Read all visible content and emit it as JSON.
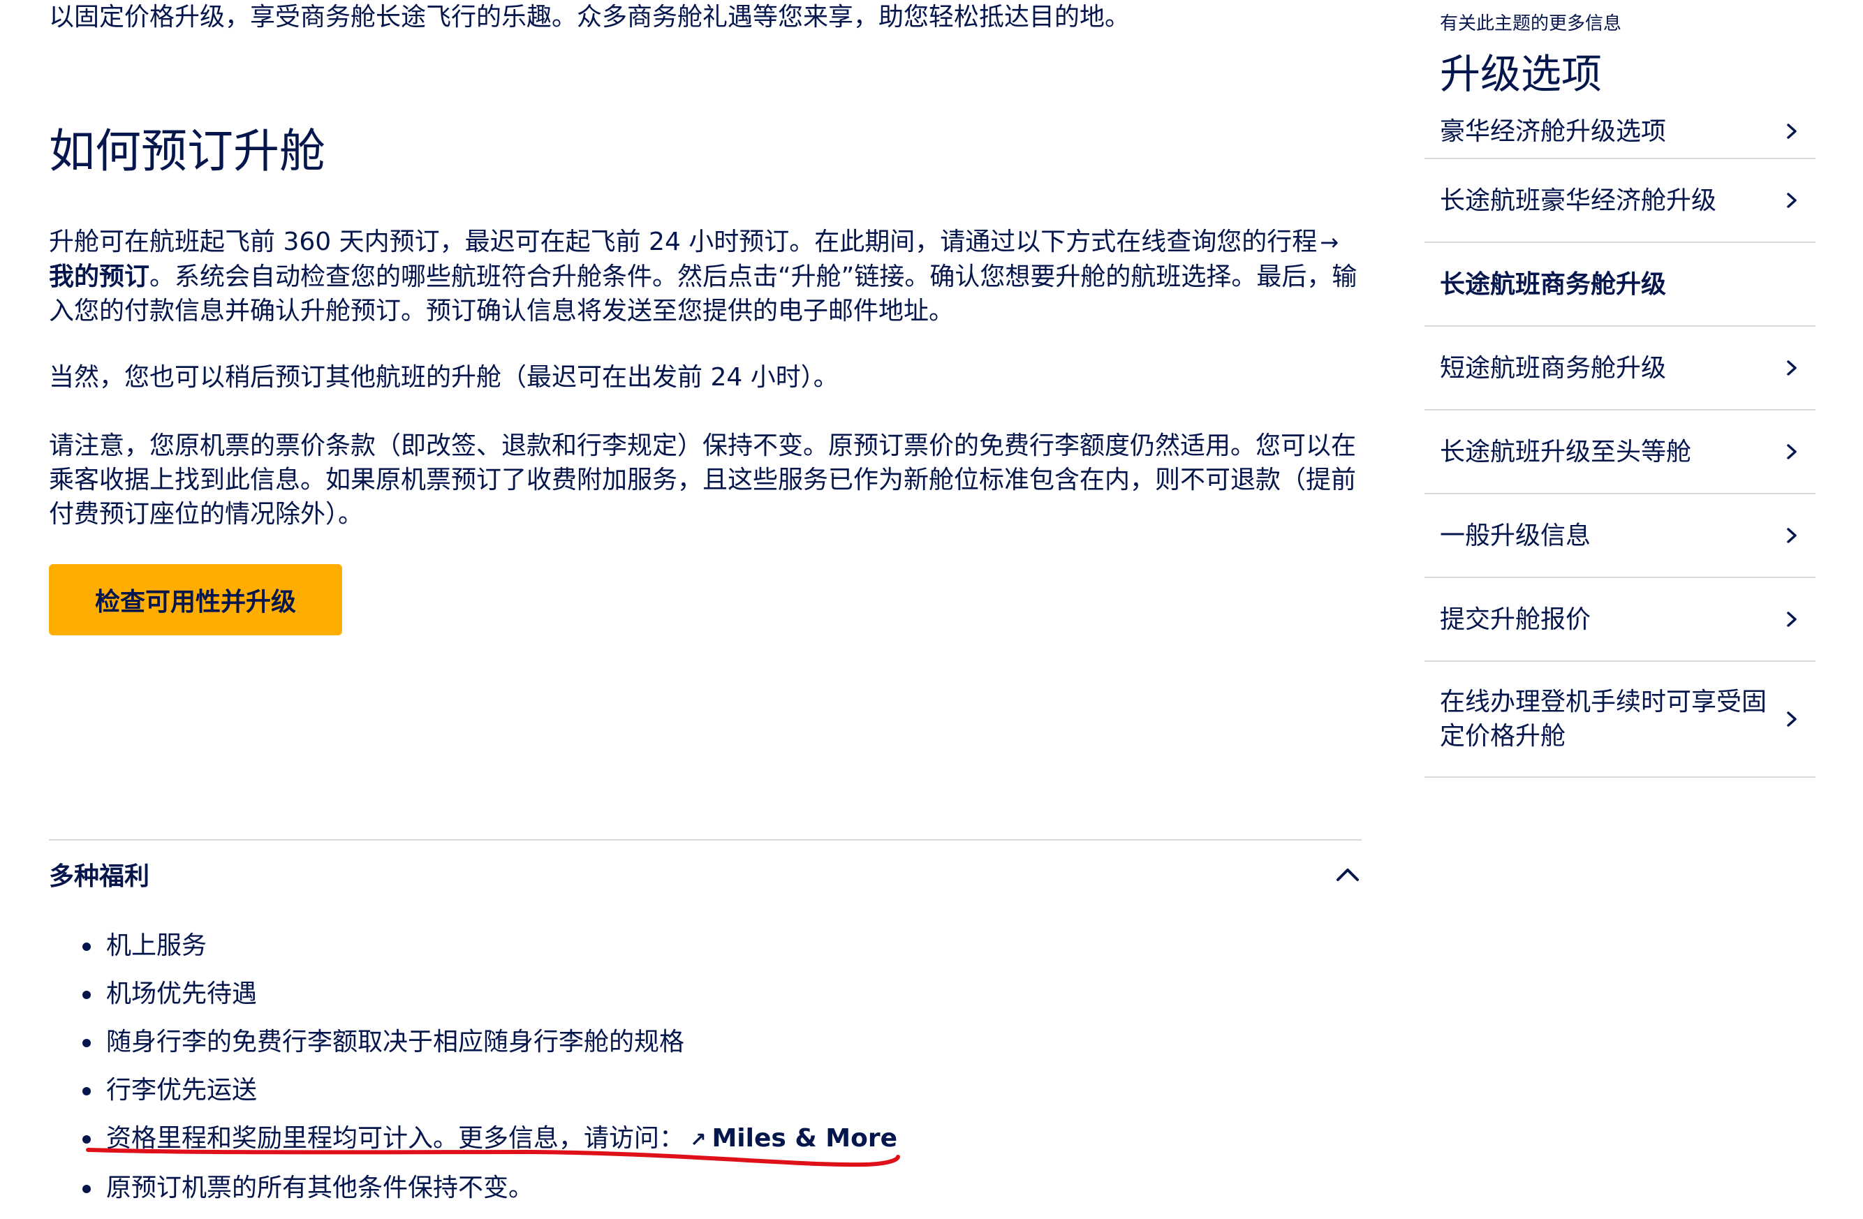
{
  "main": {
    "intro": "以固定价格升级，享受商务舱长途飞行的乐趣。众多商务舱礼遇等您来享，助您轻松抵达目的地。",
    "section_title": "如何预订升舱",
    "para1_pre": "升舱可在航班起飞前 360 天内预订，最迟可在起飞前 24 小时预订。在此期间，请通过以下方式在线查询您的行程",
    "para1_link": "我的预订",
    "para1_post": "。系统会自动检查您的哪些航班符合升舱条件。然后点击“升舱”链接。确认您想要升舱的航班选择。最后，输入您的付款信息并确认升舱预订。预订确认信息将发送至您提供的电子邮件地址。",
    "para2": "当然，您也可以稍后预订其他航班的升舱（最迟可在出发前 24 小时）。",
    "para3": "请注意，您原机票的票价条款（即改签、退款和行李规定）保持不变。原预订票价的免费行李额度仍然适用。您可以在乘客收据上找到此信息。如果原机票预订了收费附加服务，且这些服务已作为新舱位标准包含在内，则不可退款（提前付费预订座位的情况除外）。",
    "cta_label": "检查可用性并升级"
  },
  "accordion": {
    "title": "多种福利",
    "items": [
      "机上服务",
      "机场优先待遇",
      "随身行李的免费行李额取决于相应随身行李舱的规格",
      "行李优先运送",
      "资格里程和奖励里程均可计入。更多信息，请访问：",
      "原预订机票的所有其他条件保持不变。"
    ],
    "miles_link": "Miles & More"
  },
  "sidebar": {
    "eyebrow": "有关此主题的更多信息",
    "title": "升级选项",
    "items": [
      {
        "label": "豪华经济舱升级选项"
      },
      {
        "label": "长途航班豪华经济舱升级"
      },
      {
        "label": "长途航班商务舱升级"
      },
      {
        "label": "短途航班商务舱升级"
      },
      {
        "label": "长途航班升级至头等舱"
      },
      {
        "label": "一般升级信息"
      },
      {
        "label": "提交升舱报价"
      },
      {
        "label": "在线办理登机手续时可享受固定价格升舱"
      }
    ],
    "active_index": 2
  },
  "colors": {
    "text": "#05164d",
    "cta": "#ffad00",
    "divider": "#d9d9d9",
    "annotation": "#e0101a"
  },
  "icons": {
    "accordion_toggle": "chevron-up-icon",
    "sidebar_item": "chevron-right-icon",
    "inline_link": "arrow-right-icon",
    "external_link": "external-link-icon"
  }
}
